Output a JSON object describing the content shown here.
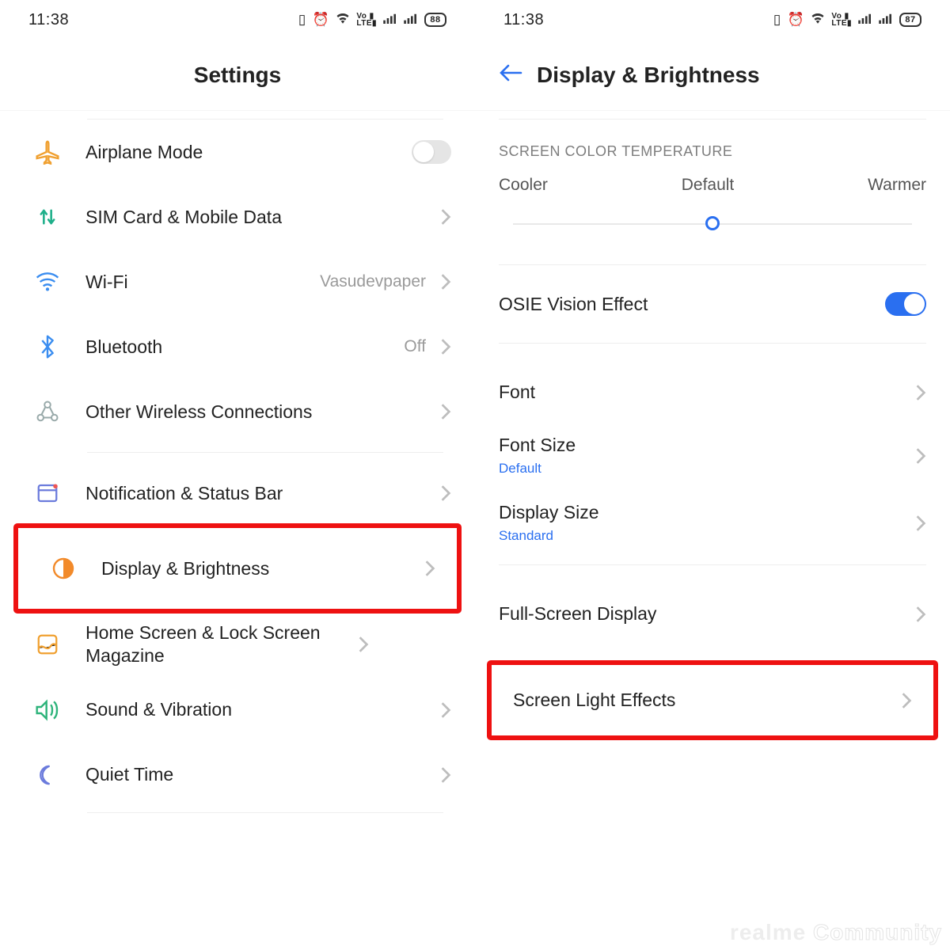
{
  "left": {
    "time": "11:38",
    "battery": "88",
    "title": "Settings",
    "items": [
      {
        "id": "airplane",
        "label": "Airplane Mode",
        "value": "",
        "toggle": "off"
      },
      {
        "id": "sim",
        "label": "SIM Card & Mobile Data",
        "value": "",
        "nav": true
      },
      {
        "id": "wifi",
        "label": "Wi-Fi",
        "value": "Vasudevpaper",
        "nav": true
      },
      {
        "id": "bt",
        "label": "Bluetooth",
        "value": "Off",
        "nav": true
      },
      {
        "id": "wireless",
        "label": "Other Wireless Connections",
        "value": "",
        "nav": true
      },
      {
        "id": "notif",
        "label": "Notification & Status Bar",
        "value": "",
        "nav": true
      },
      {
        "id": "display",
        "label": "Display & Brightness",
        "value": "",
        "nav": true,
        "highlight": true
      },
      {
        "id": "home",
        "label": "Home Screen & Lock Screen Magazine",
        "value": "",
        "nav": true
      },
      {
        "id": "sound",
        "label": "Sound & Vibration",
        "value": "",
        "nav": true
      },
      {
        "id": "quiet",
        "label": "Quiet Time",
        "value": "",
        "nav": true
      }
    ]
  },
  "right": {
    "time": "11:38",
    "battery": "87",
    "title": "Display & Brightness",
    "temp": {
      "head": "SCREEN COLOR TEMPERATURE",
      "cooler": "Cooler",
      "default": "Default",
      "warmer": "Warmer"
    },
    "osie": {
      "label": "OSIE Vision Effect",
      "on": true
    },
    "font": {
      "label": "Font"
    },
    "fontsize": {
      "label": "Font Size",
      "sub": "Default"
    },
    "displaysize": {
      "label": "Display Size",
      "sub": "Standard"
    },
    "fullscreen": {
      "label": "Full-Screen Display"
    },
    "sle": {
      "label": "Screen Light Effects",
      "highlight": true
    }
  },
  "watermark": "realme Community"
}
